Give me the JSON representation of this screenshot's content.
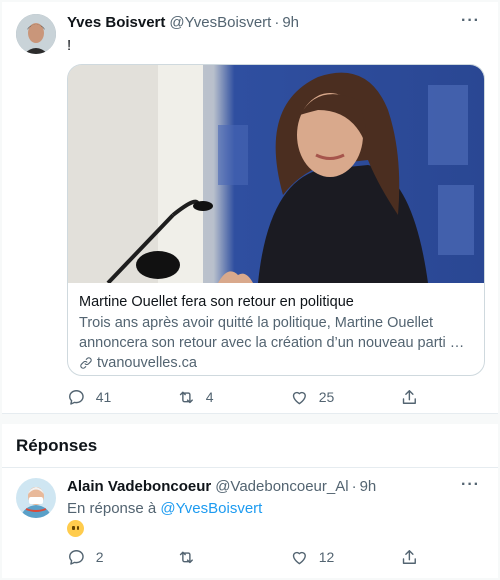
{
  "tweet": {
    "display_name": "Yves Boisvert",
    "handle": "@YvesBoisvert",
    "time": "9h",
    "text": "!",
    "card": {
      "title": "Martine Ouellet fera son retour en politique",
      "description": "Trois ans après avoir quitté la politique, Martine Ouellet annoncera son retour avec la création d’un nouveau parti …",
      "domain": "tvanouvelles.ca"
    },
    "actions": {
      "replies": "41",
      "retweets": "4",
      "likes": "25"
    }
  },
  "replies_section": {
    "title": "Réponses"
  },
  "reply": {
    "display_name": "Alain Vadeboncoeur",
    "handle": "@Vadeboncoeur_Al",
    "time": "9h",
    "context_prefix": "En réponse à",
    "context_handle": "@YvesBoisvert",
    "emoji": "😶",
    "actions": {
      "replies": "2",
      "retweets": "",
      "likes": "12"
    }
  },
  "colors": {
    "secondary_text": "#536471",
    "link": "#1d9bf0",
    "border": "#cfd9de"
  },
  "icons": [
    "more-icon",
    "link-icon",
    "reply-icon",
    "retweet-icon",
    "like-icon",
    "share-icon"
  ]
}
